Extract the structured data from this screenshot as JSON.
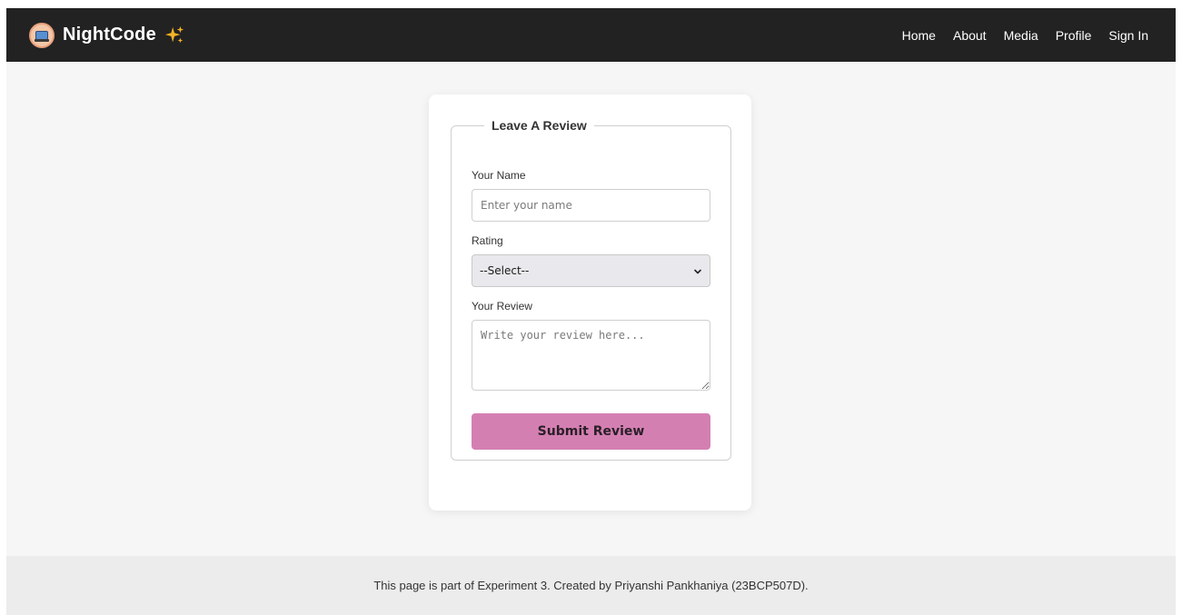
{
  "navbar": {
    "brand": "NightCode",
    "links": [
      "Home",
      "About",
      "Media",
      "Profile",
      "Sign In"
    ]
  },
  "form": {
    "legend": "Leave A Review",
    "name_label": "Your Name",
    "name_placeholder": "Enter your name",
    "rating_label": "Rating",
    "rating_selected": "--Select--",
    "review_label": "Your Review",
    "review_placeholder": "Write your review here...",
    "submit_label": "Submit Review"
  },
  "footer": {
    "text": "This page is part of Experiment 3. Created by Priyanshi Pankhaniya (23BCP507D)."
  },
  "colors": {
    "navbar_bg": "#222222",
    "accent": "#d47fb2",
    "page_bg": "#f6f6f6"
  }
}
